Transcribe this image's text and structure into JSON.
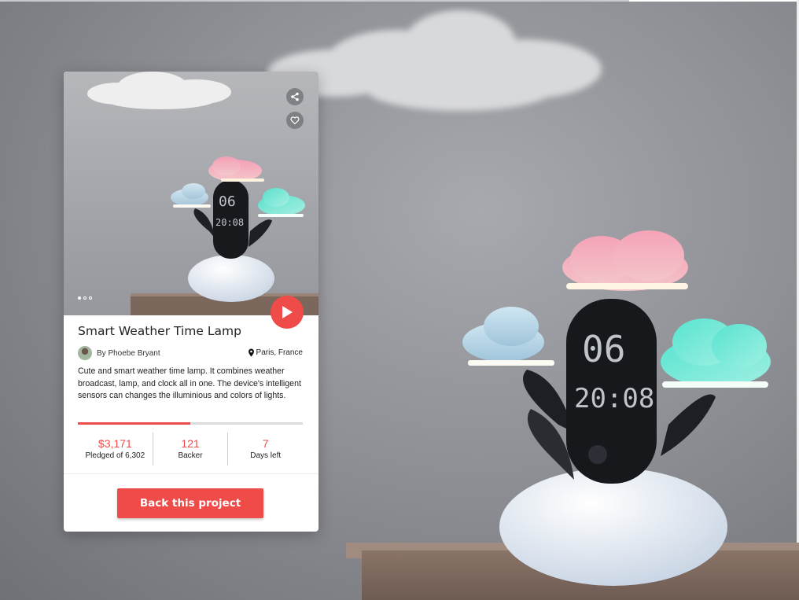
{
  "project": {
    "title": "Smart Weather Time Lamp",
    "author": "By Phoebe Bryant",
    "location": "Paris, France",
    "description": "Cute and smart weather time lamp. It combines weather broadcast, lamp, and clock all in one. The device's intelligent sensors can changes the illuminious and colors of lights.",
    "funding_progress": 0.5,
    "lamp_display": {
      "top": "06",
      "bottom": "20:08"
    }
  },
  "stats": [
    {
      "value": "$3,171",
      "label": "Pledged of 6,302"
    },
    {
      "value": "121",
      "label": "Backer"
    },
    {
      "value": "7",
      "label": "Days left"
    }
  ],
  "carousel": {
    "total": 3,
    "active": 0
  },
  "actions": {
    "back_label": "Back this project"
  },
  "icons": {
    "share": "share-icon",
    "favorite": "heart-icon",
    "play": "play-icon",
    "location": "map-pin-icon"
  },
  "colors": {
    "accent": "#ef4b49"
  }
}
